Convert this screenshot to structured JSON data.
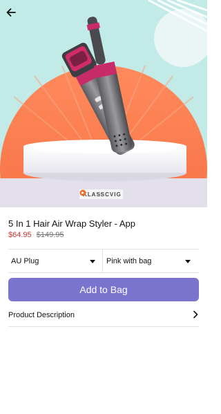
{
  "hero": {
    "back_icon": "arrow-left-icon",
    "brand_text": "KLASSCVIG",
    "dots_count": 4,
    "active_dot": 1
  },
  "product": {
    "title": "5 In 1 Hair Air Wrap Styler - App",
    "price": "$64.95",
    "compare_price": "$149.95"
  },
  "options": {
    "plug": "AU Plug",
    "color": "Pink with bag"
  },
  "actions": {
    "add_to_bag": "Add to Bag"
  },
  "description": {
    "label": "Product Description",
    "chevron_icon": "chevron-right-icon"
  },
  "colors": {
    "accent": "#7b74cf",
    "sale": "#d0312d",
    "hero_bg": "#bfe8e6",
    "hero_sun": "#ff7a4d"
  }
}
